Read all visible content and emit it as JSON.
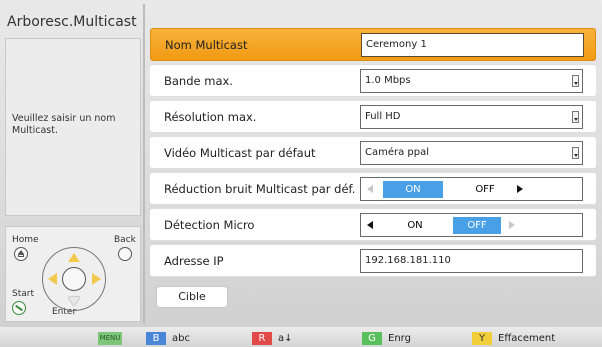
{
  "sidebar": {
    "title": "Arboresc.Multicast",
    "message": "Veuillez saisir un nom Multicast.",
    "controls": {
      "home": "Home",
      "back": "Back",
      "start": "Start",
      "enter": "Enter"
    }
  },
  "settings": {
    "rows": [
      {
        "label": "Nom Multicast",
        "value": "Ceremony 1"
      },
      {
        "label": "Bande max.",
        "value": "1.0 Mbps"
      },
      {
        "label": "Résolution max.",
        "value": "Full HD"
      },
      {
        "label": "Vidéo Multicast par défaut",
        "value": "Caméra ppal"
      },
      {
        "label": "Réduction bruit Multicast par déf.",
        "on": "ON",
        "off": "OFF",
        "selected": "ON"
      },
      {
        "label": "Détection Micro",
        "on": "ON",
        "off": "OFF",
        "selected": "OFF"
      },
      {
        "label": "Adresse IP",
        "value": "192.168.181.110"
      }
    ],
    "target_button": "Cible"
  },
  "footer": {
    "keys": [
      {
        "key": "MENU",
        "label": "",
        "color": "#7cc67a"
      },
      {
        "key": "B",
        "label": "abc",
        "color": "#4a86d8"
      },
      {
        "key": "R",
        "label": "a↓",
        "color": "#e24a4a"
      },
      {
        "key": "G",
        "label": "Enrg",
        "color": "#58c05a"
      },
      {
        "key": "Y",
        "label": "Effacement",
        "color": "#f2cf3a"
      }
    ]
  },
  "colors": {
    "active_row": "#f5a623",
    "on_highlight": "#4aa0e6"
  }
}
